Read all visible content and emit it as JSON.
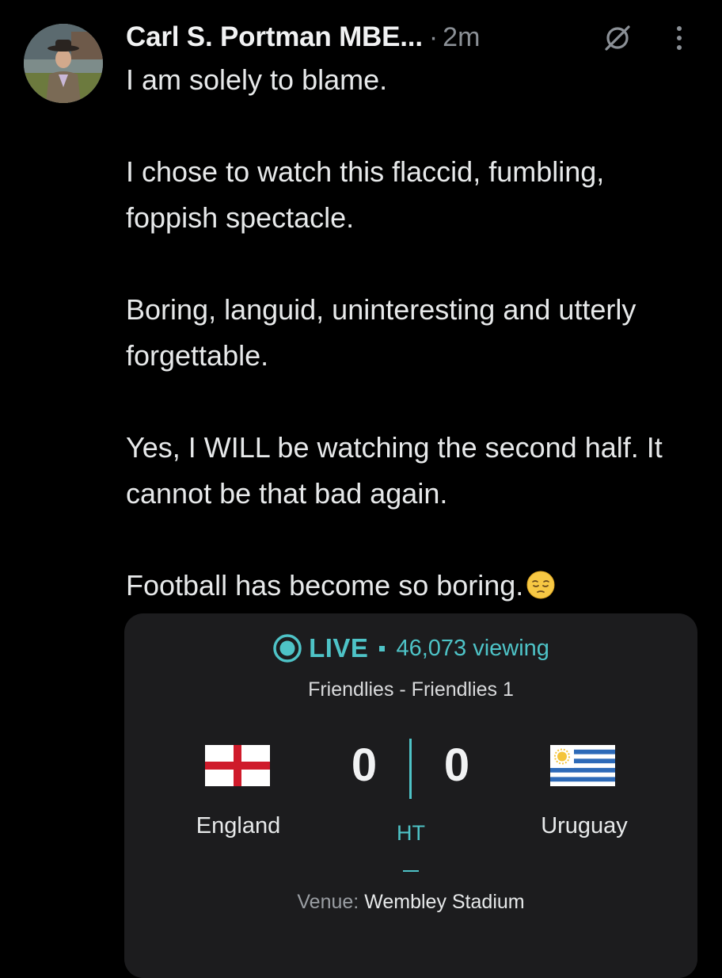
{
  "tweet": {
    "author_name": "Carl S. Portman MBE...",
    "separator": "·",
    "timestamp": "2m",
    "paragraphs": [
      "I am solely to blame.",
      "I chose to watch this flaccid, fumbling, foppish spectacle.",
      "Boring, languid, uninteresting and utterly forgettable.",
      "Yes, I WILL be watching the second half. It cannot be that bad again.",
      "Football has become so boring."
    ],
    "emoji": "pensive-face",
    "icons": {
      "avatar": "avatar-photo",
      "grok": "grok-icon",
      "more": "more-options-icon"
    }
  },
  "live_card": {
    "live_label": "LIVE",
    "viewing": "46,073 viewing",
    "competition": "Friendlies - Friendlies 1",
    "home_team": "England",
    "away_team": "Uruguay",
    "home_score": "0",
    "away_score": "0",
    "status": "HT",
    "venue_label": "Venue:",
    "venue_value": "Wembley Stadium",
    "accent_color": "#4ec3c7"
  }
}
